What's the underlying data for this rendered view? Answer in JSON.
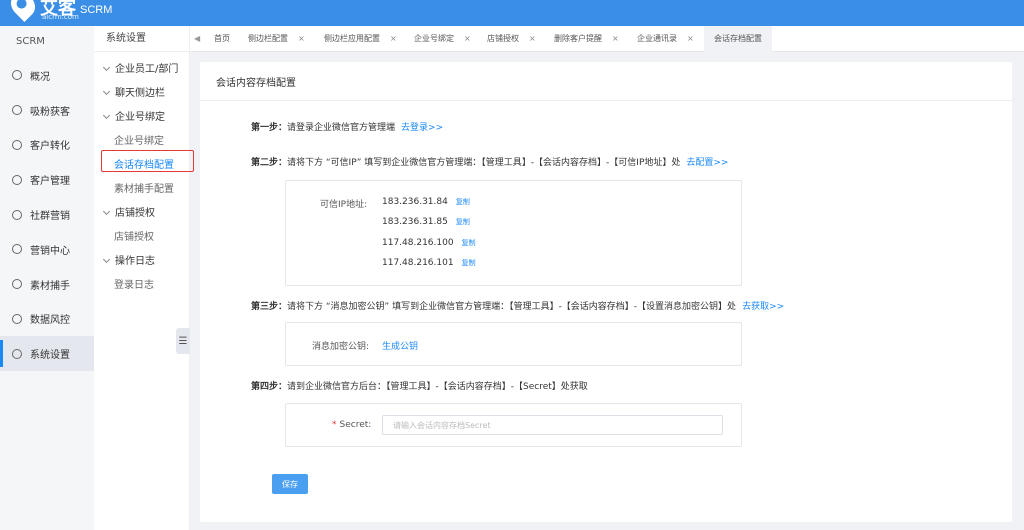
{
  "header": {
    "logo_text": "艾客",
    "logo_url": "aicrm.com",
    "brand": "SCRM"
  },
  "nav": {
    "title": "SCRM",
    "items": [
      {
        "label": "概况",
        "icon": "home-icon"
      },
      {
        "label": "吸粉获客",
        "icon": "user-add-icon"
      },
      {
        "label": "客户转化",
        "icon": "convert-icon"
      },
      {
        "label": "客户管理",
        "icon": "customers-icon"
      },
      {
        "label": "社群营销",
        "icon": "group-icon"
      },
      {
        "label": "营销中心",
        "icon": "marketing-icon"
      },
      {
        "label": "素材捕手",
        "icon": "material-icon"
      },
      {
        "label": "数据风控",
        "icon": "shield-icon"
      },
      {
        "label": "系统设置",
        "icon": "gear-icon"
      }
    ],
    "active": "系统设置"
  },
  "subnav": {
    "title": "系统设置",
    "groups": [
      {
        "label": "企业员工/部门"
      },
      {
        "label": "聊天侧边栏"
      },
      {
        "label": "企业号绑定",
        "items": [
          "企业号绑定",
          "会话存档配置",
          "素材捕手配置"
        ]
      },
      {
        "label": "店铺授权",
        "items": [
          "店铺授权"
        ]
      },
      {
        "label": "操作日志",
        "items": [
          "登录日志"
        ]
      }
    ],
    "current": "会话存档配置"
  },
  "tabs": {
    "items": [
      {
        "label": "首页",
        "closable": false
      },
      {
        "label": "侧边栏配置",
        "closable": true
      },
      {
        "label": "侧边栏应用配置",
        "closable": true
      },
      {
        "label": "企业号绑定",
        "closable": true
      },
      {
        "label": "店铺授权",
        "closable": true
      },
      {
        "label": "删除客户提醒",
        "closable": true
      },
      {
        "label": "企业通讯录",
        "closable": true
      },
      {
        "label": "会话存档配置",
        "closable": false
      }
    ],
    "active_index": 7,
    "close_glyph": "×"
  },
  "card": {
    "title": "会话内容存档配置",
    "step1": {
      "label": "第一步：",
      "text": "请登录企业微信官方管理端",
      "link": "去登录>>"
    },
    "step2": {
      "label": "第二步：",
      "text": "请将下方 “可信IP” 填写到企业微信官方管理端：【管理工具】-【会话内容存档】-【可信IP地址】处",
      "link": "去配置>>"
    },
    "ip_label": "可信IP地址:",
    "ips": [
      "183.236.31.84",
      "183.236.31.85",
      "117.48.216.100",
      "117.48.216.101"
    ],
    "copy_label": "复制",
    "step3": {
      "label": "第三步：",
      "text": "请将下方 “消息加密公钥” 填写到企业微信官方管理端：【管理工具】-【会话内容存档】-【设置消息加密公钥】处",
      "link": "去获取>>"
    },
    "key_label": "消息加密公钥:",
    "key_link": "生成公钥",
    "step4": {
      "label": "第四步：",
      "text": "请到企业微信官方后台：【管理工具】-【会话内容存档】-【Secret】处获取"
    },
    "secret_label": "Secret:",
    "secret_required": "*",
    "secret_placeholder": "请输入会话内容存档Secret",
    "secret_value": "",
    "save_label": "保存"
  }
}
